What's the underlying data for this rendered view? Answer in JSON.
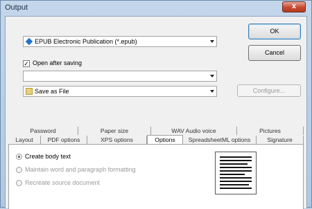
{
  "window": {
    "title": "Output",
    "close_label": "x"
  },
  "format_combo": {
    "icon": "epub-icon",
    "value": "EPUB Electronic Publication (*.epub)"
  },
  "open_after_saving": {
    "label": "Open after saving",
    "checked": true
  },
  "application_combo": {
    "value": ""
  },
  "save_combo": {
    "icon": "folder-icon",
    "value": "Save as File"
  },
  "buttons": {
    "ok": "OK",
    "cancel": "Cancel",
    "configure": "Configure..."
  },
  "tabs": {
    "row1": [
      "Password",
      "Paper size",
      "WAV Audio voice",
      "Pictures"
    ],
    "row2": [
      "Layout",
      "PDF options",
      "XPS options",
      "Options",
      "SpreadsheetML options",
      "Signature"
    ],
    "active": "Options"
  },
  "options": {
    "create_body_text": "Create body text",
    "maintain_formatting": "Maintain word and paragraph formatting",
    "recreate_source": "Recreate source document",
    "selected": "create_body_text"
  }
}
